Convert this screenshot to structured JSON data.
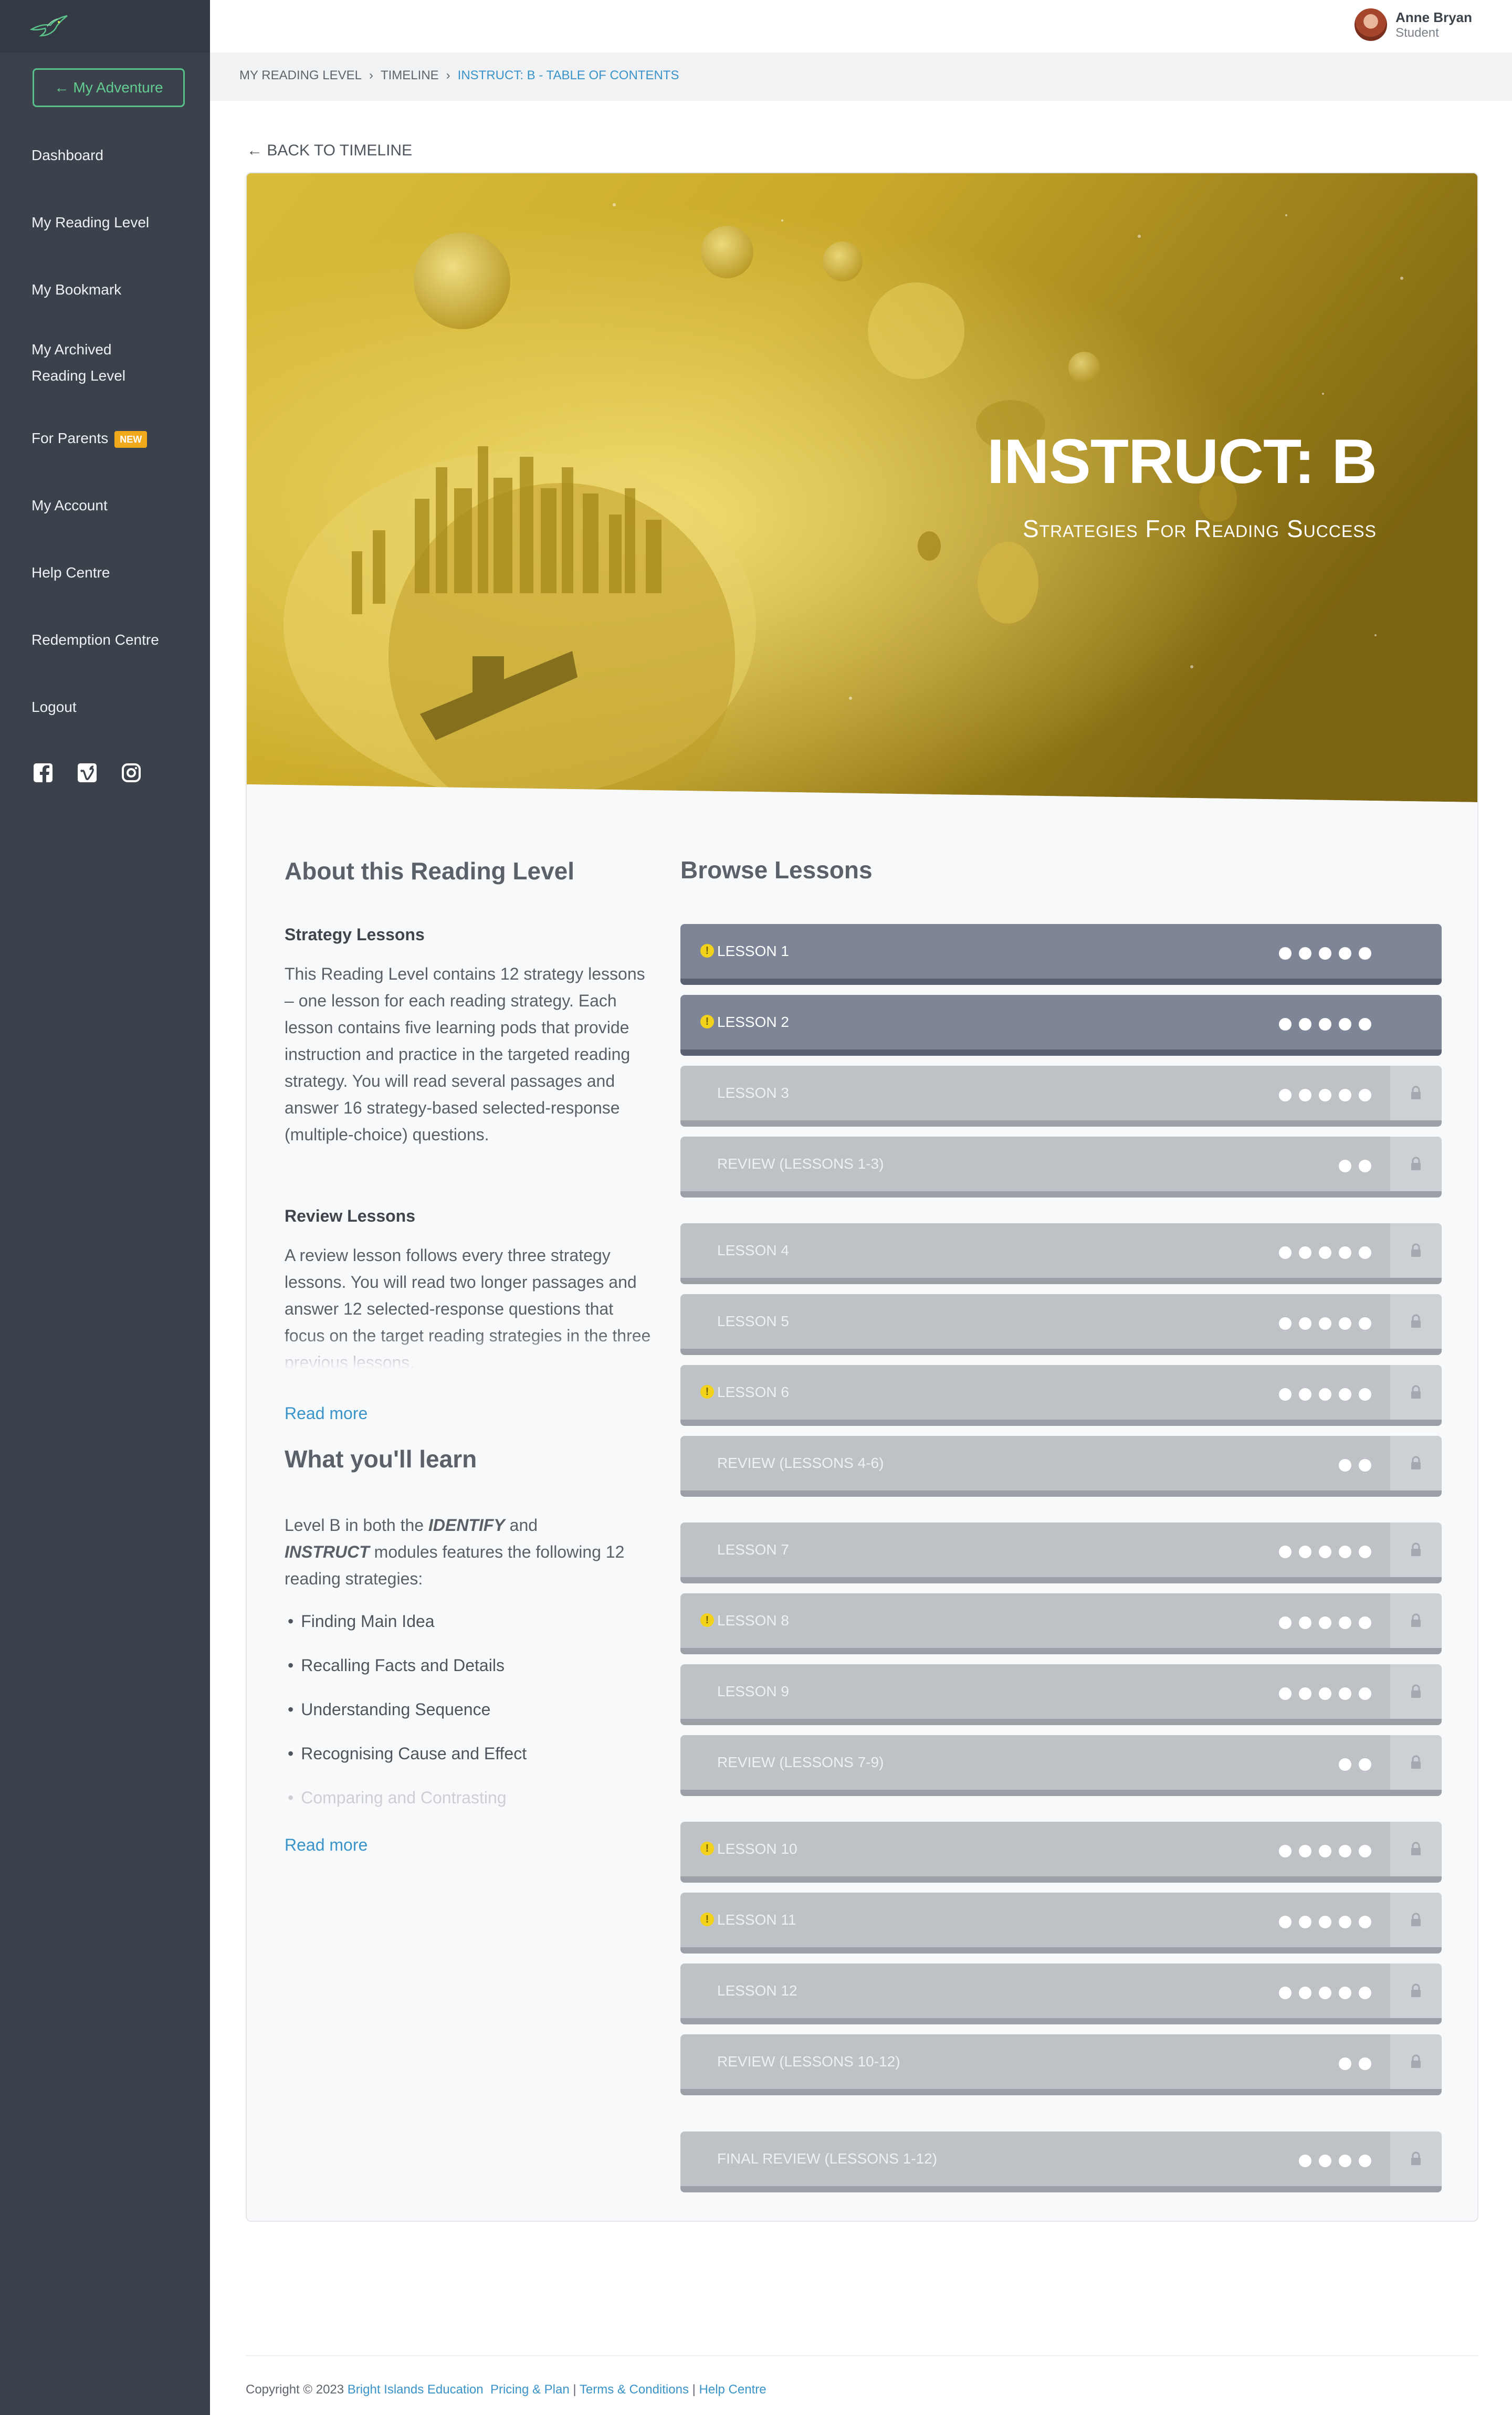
{
  "sidebar": {
    "adventure_button": "My Adventure",
    "items": [
      {
        "label": "Dashboard"
      },
      {
        "label": "My Reading Level"
      },
      {
        "label": "My Bookmark"
      },
      {
        "label": "My Archived"
      },
      {
        "label": "Reading Level"
      },
      {
        "label": "For Parents",
        "badge": "NEW"
      },
      {
        "label": "My Account"
      },
      {
        "label": "Help Centre"
      },
      {
        "label": "Redemption Centre"
      },
      {
        "label": "Logout"
      }
    ],
    "social_icons": [
      "facebook-icon",
      "vimeo-icon",
      "instagram-icon"
    ]
  },
  "header": {
    "user_name": "Anne Bryan",
    "user_role": "Student"
  },
  "breadcrumb": {
    "items": [
      "MY READING LEVEL",
      "TIMELINE",
      "INSTRUCT: B - TABLE OF CONTENTS"
    ]
  },
  "back_link": "BACK TO TIMELINE",
  "hero": {
    "title": "INSTRUCT: B",
    "subtitle": "Strategies For Reading Success"
  },
  "about": {
    "heading": "About this Reading Level",
    "strategy_heading": "Strategy Lessons",
    "strategy_text": "This Reading Level contains 12 strategy lessons – one lesson for each reading strategy. Each lesson contains five learning pods that provide instruction and practice in the targeted reading strategy. You will read several passages and answer 16 strategy-based selected-response (multiple-choice) questions.",
    "review_heading": "Review Lessons",
    "review_text": "A review lesson follows every three strategy lessons. You will read two longer passages and answer 12 selected-response questions that focus on the target reading strategies in the three previous lessons.",
    "read_more": "Read more"
  },
  "learn": {
    "heading": "What you'll learn",
    "intro_pre": "Level B in both the",
    "intro_identify": "IDENTIFY",
    "intro_and": "and",
    "intro_instruct": "INSTRUCT",
    "intro_post": "modules features the following 12 reading strategies:",
    "strategies": [
      "Finding Main Idea",
      "Recalling Facts and Details",
      "Understanding Sequence",
      "Recognising Cause and Effect",
      "Comparing and Contrasting"
    ],
    "read_more": "Read more"
  },
  "browse": {
    "heading": "Browse Lessons",
    "lessons": [
      {
        "label": "LESSON 1",
        "dots": 5,
        "star": true,
        "locked": false
      },
      {
        "label": "LESSON 2",
        "dots": 5,
        "star": true,
        "locked": false
      },
      {
        "label": "LESSON 3",
        "dots": 5,
        "star": false,
        "locked": true
      },
      {
        "label": "REVIEW (LESSONS 1-3)",
        "dots": 2,
        "star": false,
        "locked": true
      },
      {
        "label": "LESSON 4",
        "dots": 5,
        "star": false,
        "locked": true
      },
      {
        "label": "LESSON 5",
        "dots": 5,
        "star": false,
        "locked": true
      },
      {
        "label": "LESSON 6",
        "dots": 5,
        "star": true,
        "locked": true
      },
      {
        "label": "REVIEW (LESSONS 4-6)",
        "dots": 2,
        "star": false,
        "locked": true
      },
      {
        "label": "LESSON 7",
        "dots": 5,
        "star": false,
        "locked": true
      },
      {
        "label": "LESSON 8",
        "dots": 5,
        "star": true,
        "locked": true
      },
      {
        "label": "LESSON 9",
        "dots": 5,
        "star": false,
        "locked": true
      },
      {
        "label": "REVIEW (LESSONS 7-9)",
        "dots": 2,
        "star": false,
        "locked": true
      },
      {
        "label": "LESSON 10",
        "dots": 5,
        "star": true,
        "locked": true
      },
      {
        "label": "LESSON 11",
        "dots": 5,
        "star": true,
        "locked": true
      },
      {
        "label": "LESSON 12",
        "dots": 5,
        "star": false,
        "locked": true
      },
      {
        "label": "REVIEW (LESSONS 10-12)",
        "dots": 2,
        "star": false,
        "locked": true
      },
      {
        "label": "FINAL REVIEW (LESSONS 1-12)",
        "dots": 4,
        "star": false,
        "locked": true
      }
    ]
  },
  "footer": {
    "copyright": "Copyright © 2023",
    "company": "Bright Islands Education",
    "pricing": "Pricing & Plan",
    "terms": "Terms & Conditions",
    "help": "Help Centre",
    "sep": "|"
  },
  "colors": {
    "sidebar_bg": "#3b424c",
    "accent_green": "#55c089",
    "link_blue": "#3a93c9",
    "lesson_active": "#7d8597",
    "lesson_locked": "#bec2c7",
    "hero_gold": "#c9a92a",
    "badge_orange": "#f0a81d"
  }
}
